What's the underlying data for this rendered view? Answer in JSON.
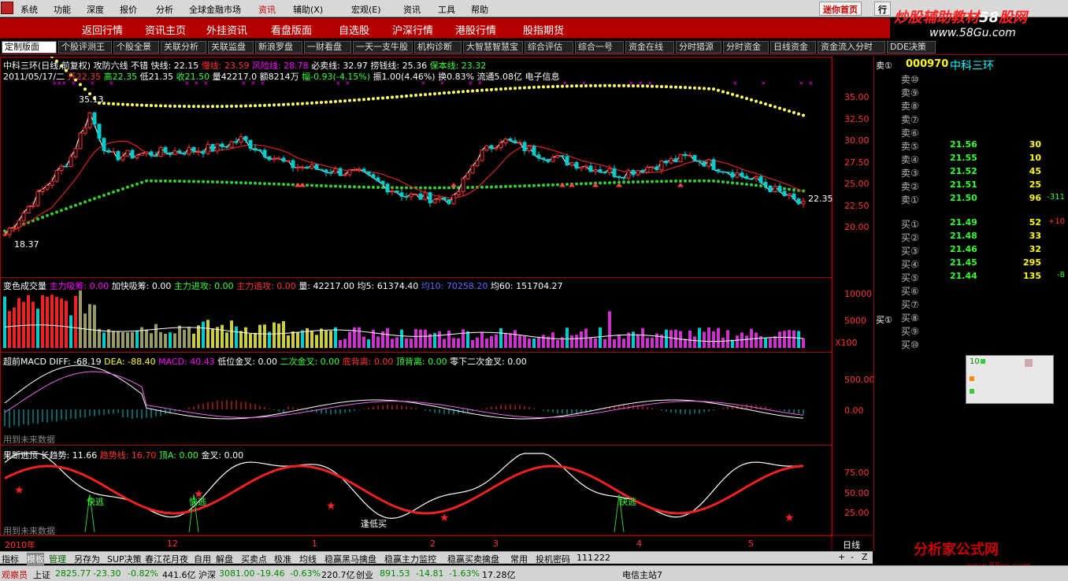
{
  "menu": {
    "items": [
      "系统",
      "功能",
      "深度",
      "报价",
      "分析",
      "全球金融市场",
      "资讯",
      "辅助(X)",
      "宏观(E)",
      "资讯",
      "工具",
      "帮助"
    ],
    "mini_button": "迷你首页",
    "right_tab": "行"
  },
  "watermark": {
    "site_pre": "炒股辅助教材",
    "site_mid": "58",
    "site_post": "股网",
    "url": "www.58Gu.com",
    "logo2": "分析家公式网",
    "url2": "www.88gs.com"
  },
  "nav": [
    "返回行情",
    "资讯主页",
    "外挂资讯",
    "看盘版面",
    "自选股",
    "沪深行情",
    "港股行情",
    "股指期货"
  ],
  "tabs": {
    "items": [
      "定制版面",
      "个股评测王",
      "个股全景",
      "关联分析",
      "关联监盘",
      "新浪罗盘",
      "一财看盘",
      "一天一支牛股",
      "机构诊断",
      "大智慧智慧宝",
      "综合评估",
      "综合一号",
      "资金在线",
      "分时猎源",
      "分时资金",
      "日线资金",
      "资金流入分时",
      "DDE决策"
    ],
    "active": 0
  },
  "header": {
    "line1": [
      [
        "中科三环(日线,前复权) 攻防六线 不错 快线: 22.15 ",
        "wh"
      ],
      [
        "慢线: 23.59 ",
        "rd"
      ],
      [
        "风险线: 28.78 ",
        "mg"
      ],
      [
        "必卖线: 32.97 ",
        "wh"
      ],
      [
        "捞钱线: 25.36 ",
        "wh"
      ],
      [
        "保本线: 23.32",
        "gr"
      ]
    ],
    "line2": [
      [
        "2011/05/17/二 ",
        "wh"
      ],
      [
        "开22.35 ",
        "rd"
      ],
      [
        "高22.35 ",
        "gr"
      ],
      [
        "低21.35 ",
        "wh"
      ],
      [
        "收21.50 ",
        "gr"
      ],
      [
        "量42217.0 额8214万 ",
        "wh"
      ],
      [
        "幅-0.93(-4.15%) ",
        "gr"
      ],
      [
        "振1.00(4.46%) 换0.83% 流通5.08亿 电子信息",
        "wh"
      ]
    ]
  },
  "price_axis": [
    "35.00",
    "32.50",
    "30.00",
    "27.50",
    "25.00",
    "22.50",
    "20.00"
  ],
  "price_labels": {
    "high": "35.13",
    "low": "18.37",
    "last": "22.35"
  },
  "vol_header": [
    [
      "变色成交量 ",
      "wh"
    ],
    [
      "主力吸筹: 0.00 ",
      "mg"
    ],
    [
      "加快吸筹: 0.00 ",
      "wh"
    ],
    [
      "主力进攻: 0.00 ",
      "gr"
    ],
    [
      "主力追攻: 0.00 ",
      "rd"
    ],
    [
      "量: 42217.00 ",
      "wh"
    ],
    [
      "均5: 61374.40 ",
      "wh"
    ],
    [
      "均10: 70258.20 ",
      "bl"
    ],
    [
      "均60: 151704.27",
      "wh"
    ]
  ],
  "vol_axis": [
    "10000",
    "5000"
  ],
  "vol_unit": "X100",
  "macd_header": [
    [
      "超前MACD ",
      "wh"
    ],
    [
      "DIFF: -68.19 ",
      "wh"
    ],
    [
      "DEA: -88.40 ",
      "ye"
    ],
    [
      "MACD: 40.43 ",
      "mg"
    ],
    [
      "低位金叉: 0.00 ",
      "wh"
    ],
    [
      "二次金叉: 0.00 ",
      "gr"
    ],
    [
      "底背离: 0.00 ",
      "rd"
    ],
    [
      "顶背离: 0.00 ",
      "gr"
    ],
    [
      "零下二次金叉: 0.00",
      "wh"
    ]
  ],
  "macd_axis": [
    "500.00",
    "0.00"
  ],
  "macd_note": "用到未来数据",
  "escape_header": [
    [
      "果断逃顶 ",
      "wh"
    ],
    [
      "长趋势: 11.66 ",
      "wh"
    ],
    [
      "趋势线: 16.70 ",
      "rd"
    ],
    [
      "顶A: 0.00 ",
      "gr"
    ],
    [
      "金叉: 0.00",
      "wh"
    ]
  ],
  "escape_axis": [
    "75.00",
    "50.00",
    "25.00"
  ],
  "escape_note": "用到未来数据",
  "escape_label": "快逃",
  "low_buy": "逢低买",
  "date_axis": [
    "2010年",
    "12",
    "1",
    "2",
    "3",
    "4",
    "5"
  ],
  "period": "日线",
  "stock": {
    "code": "000970",
    "name": "中科三环"
  },
  "orderbook": {
    "sell": [
      [
        "卖⑩",
        "",
        "",
        ""
      ],
      [
        "卖⑨",
        "",
        "",
        ""
      ],
      [
        "卖⑧",
        "",
        "",
        ""
      ],
      [
        "卖⑦",
        "",
        "",
        ""
      ],
      [
        "卖⑥",
        "",
        "",
        ""
      ],
      [
        "卖⑤",
        "21.56",
        "30",
        ""
      ],
      [
        "卖④",
        "21.55",
        "10",
        ""
      ],
      [
        "卖③",
        "21.52",
        "45",
        ""
      ],
      [
        "卖②",
        "21.51",
        "25",
        ""
      ],
      [
        "卖①",
        "21.50",
        "96",
        "-311"
      ]
    ],
    "buy": [
      [
        "买①",
        "21.49",
        "52",
        "+10"
      ],
      [
        "买②",
        "21.48",
        "33",
        ""
      ],
      [
        "买③",
        "21.46",
        "32",
        ""
      ],
      [
        "买④",
        "21.45",
        "295",
        ""
      ],
      [
        "买⑤",
        "21.44",
        "135",
        "-8"
      ],
      [
        "买⑥",
        "",
        "",
        ""
      ],
      [
        "买⑦",
        "",
        "",
        ""
      ],
      [
        "买⑧",
        "",
        "",
        ""
      ],
      [
        "买⑨",
        "",
        "",
        ""
      ],
      [
        "买⑩",
        "",
        "",
        ""
      ]
    ],
    "sell_side": "卖①",
    "buy_side": "买①"
  },
  "popup": {
    "title": "10"
  },
  "bottom_tabs": [
    "指标",
    "模板",
    "管理",
    "另存为",
    "SUP决策",
    "春江花月夜",
    "自用",
    "解盘",
    "买卖点",
    "极准",
    "均线",
    "稳赢黑马擒盘",
    "稳赢主力监控",
    "稳赢买卖擒盘",
    "常用",
    "投机密码",
    "111",
    "222"
  ],
  "nav_arrows": [
    "+",
    "-",
    "Z"
  ],
  "status": [
    [
      "观察员",
      "#c00"
    ],
    [
      "上证",
      "#000"
    ],
    [
      "2825.77",
      "#080"
    ],
    [
      "-23.30",
      "#080"
    ],
    [
      "-0.82%",
      "#080"
    ],
    [
      "441.6亿",
      "#000"
    ],
    [
      "沪深",
      "#000"
    ],
    [
      "3081.00",
      "#080"
    ],
    [
      "-19.46",
      "#080"
    ],
    [
      "-0.63%",
      "#080"
    ],
    [
      "220.7亿",
      "#000"
    ],
    [
      "创业",
      "#000"
    ],
    [
      "891.53",
      "#080"
    ],
    [
      "-14.81",
      "#080"
    ],
    [
      "-1.63%",
      "#080"
    ],
    [
      "17.28亿",
      "#000"
    ],
    [
      "电信主站7",
      "#000"
    ]
  ]
}
